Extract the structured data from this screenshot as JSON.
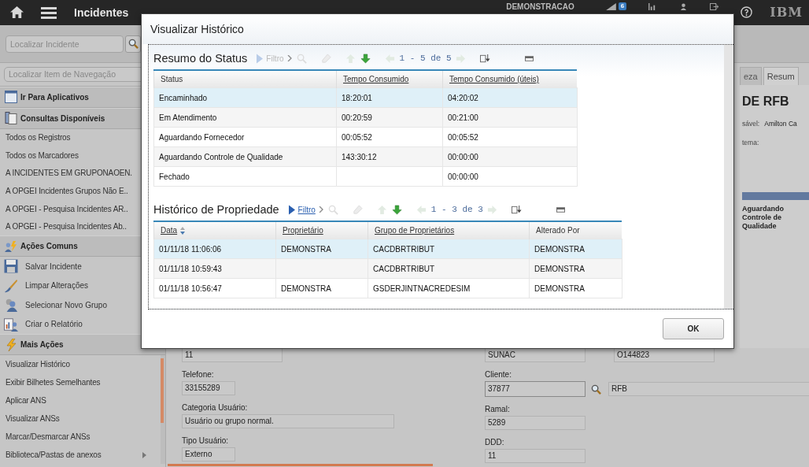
{
  "top_bar": {
    "title": "Incidentes",
    "user": "DEMONSTRACAO",
    "notification_count": "6",
    "brand": "IBM"
  },
  "toolbar": {
    "search": {
      "placeholder": "Localizar Incidente"
    }
  },
  "sidebar": {
    "search": {
      "placeholder": "Localizar Item de Navegação"
    },
    "sections": [
      {
        "title": "Ir Para Aplicativos"
      },
      {
        "title": "Consultas Disponíveis",
        "items": [
          {
            "label": "Todos os Registros"
          },
          {
            "label": "Todos os Marcadores"
          },
          {
            "label": "A INCIDENTES EM GRUPONAOEN."
          },
          {
            "label": "A OPGEI Incidentes Grupos Não E.."
          },
          {
            "label": "A OPGEI - Pesquisa Incidentes AR.."
          },
          {
            "label": "A OPGEI - Pesquisa Incidentes Ab.."
          }
        ]
      },
      {
        "title": "Ações Comuns",
        "items": [
          {
            "label": "Salvar Incidente"
          },
          {
            "label": "Limpar Alterações"
          },
          {
            "label": "Selecionar Novo Grupo"
          },
          {
            "label": "Criar o Relatório"
          }
        ]
      },
      {
        "title": "Mais Ações",
        "items": [
          {
            "label": "Visualizar Histórico",
            "submenu": false
          },
          {
            "label": "Exibir Bilhetes Semelhantes",
            "submenu": false
          },
          {
            "label": "Aplicar ANS",
            "submenu": false
          },
          {
            "label": "Visualizar ANSs",
            "submenu": false
          },
          {
            "label": "Marcar/Desmarcar ANSs",
            "submenu": false
          },
          {
            "label": "Biblioteca/Pastas de anexos",
            "submenu": true
          }
        ]
      }
    ]
  },
  "record": {
    "tabs": [
      {
        "label": "eza",
        "selected": false
      },
      {
        "label": "Resum",
        "selected": true
      }
    ],
    "title": "DE RFB",
    "fields": [
      {
        "label": "sável:",
        "value": "Amilton Ca"
      },
      {
        "label": "tema:"
      }
    ],
    "status_step": "Aguardando Controle de Qualidade"
  },
  "form": {
    "left": [
      {
        "value": "11"
      },
      {
        "label": "Telefone:",
        "value": "33155289"
      },
      {
        "label": "Categoria Usuário:",
        "value": "Usuário ou grupo normal."
      },
      {
        "label": "Tipo Usuário:",
        "value": "Externo"
      }
    ],
    "right_top": [
      "SUNAC",
      "O144823"
    ],
    "client": {
      "label": "Cliente:",
      "code": "37877",
      "name": "RFB"
    },
    "right": [
      {
        "label": "Ramal:",
        "value": "5289"
      },
      {
        "label": "DDD:",
        "value": "11"
      }
    ]
  },
  "progress": {
    "level": 0.41
  },
  "dialog": {
    "title": "Visualizar Histórico",
    "sections": [
      {
        "title": "Resumo do Status",
        "filter": {
          "label": "Filtro",
          "enabled": false
        },
        "pager": "1 - 5 de 5",
        "columns": [
          {
            "label": "Status",
            "sortable": false,
            "sorted": false
          },
          {
            "label": "Tempo Consumido",
            "sortable": true,
            "sorted": false
          },
          {
            "label": "Tempo Consumido (úteis)",
            "sortable": true,
            "sorted": false
          }
        ],
        "rows": [
          {
            "selected": true,
            "cells": [
              "Encaminhado",
              "18:20:01",
              "04:20:02"
            ]
          },
          {
            "selected": false,
            "cells": [
              "Em Atendimento",
              "00:20:59",
              "00:21:00"
            ]
          },
          {
            "selected": false,
            "cells": [
              "Aguardando Fornecedor",
              "00:05:52",
              "00:05:52"
            ]
          },
          {
            "selected": false,
            "cells": [
              "Aguardando Controle de Qualidade",
              "143:30:12",
              "00:00:00"
            ]
          },
          {
            "selected": false,
            "cells": [
              "Fechado",
              "",
              "00:00:00"
            ]
          }
        ]
      },
      {
        "title": "Histórico de Propriedade",
        "filter": {
          "label": "Filtro",
          "enabled": true
        },
        "pager": "1 - 3 de 3",
        "columns": [
          {
            "label": "Data",
            "sortable": true,
            "sorted": true
          },
          {
            "label": "Proprietário",
            "sortable": true,
            "sorted": false
          },
          {
            "label": "Grupo de Proprietários",
            "sortable": true,
            "sorted": false
          },
          {
            "label": "Alterado Por",
            "sortable": false,
            "sorted": false
          }
        ],
        "rows": [
          {
            "selected": true,
            "cells": [
              "01/11/18 11:06:06",
              "DEMONSTRA",
              "CACDBRTRIBUT",
              "DEMONSTRA"
            ]
          },
          {
            "selected": false,
            "cells": [
              "01/11/18 10:59:43",
              "",
              "CACDBRTRIBUT",
              "DEMONSTRA"
            ]
          },
          {
            "selected": false,
            "cells": [
              "01/11/18 10:56:47",
              "DEMONSTRA",
              "GSDERJINTNACREDESIM",
              "DEMONSTRA"
            ]
          }
        ]
      }
    ],
    "buttons": [
      "OK"
    ]
  }
}
